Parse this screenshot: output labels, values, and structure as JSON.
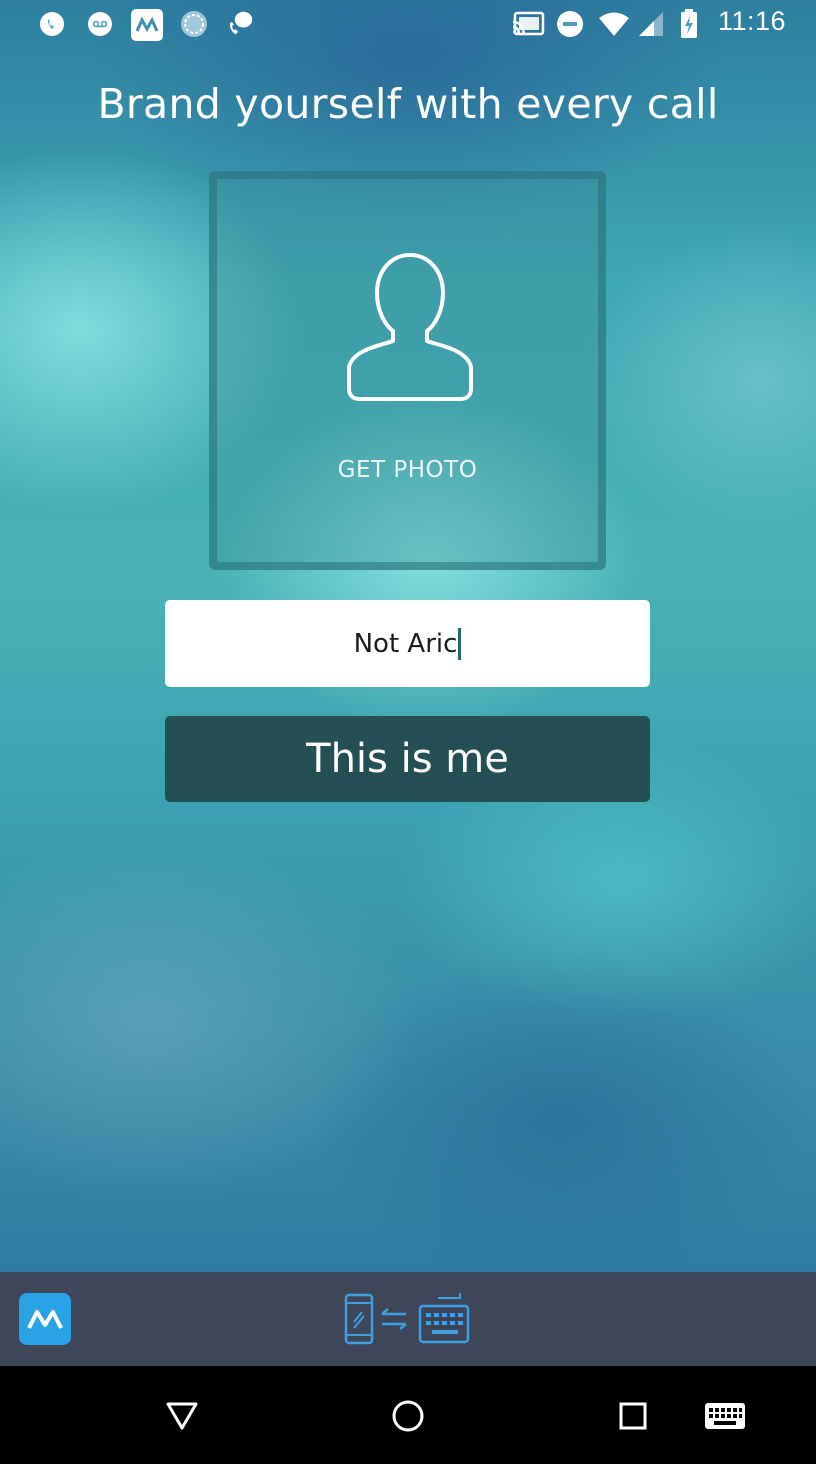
{
  "status_bar": {
    "time": "11:16",
    "left_icons": [
      "phone-icon",
      "voicemail-icon",
      "apowermirror-icon",
      "sync-circle-icon",
      "missed-call-icon"
    ],
    "right_icons": [
      "cast-icon",
      "do-not-disturb-icon",
      "wifi-icon",
      "signal-icon",
      "battery-charging-icon"
    ]
  },
  "headline": "Brand yourself with every call",
  "photo": {
    "label": "GET PHOTO",
    "icon": "person-outline-icon"
  },
  "name_input": {
    "value": "Not Aric"
  },
  "confirm_button": {
    "label": "This is me"
  },
  "app_bar": {
    "logo_icon": "apowermirror-logo-icon",
    "center_icon": "phone-to-keyboard-icon"
  },
  "nav_bar": {
    "buttons": [
      "back-icon",
      "home-icon",
      "recents-icon",
      "keyboard-icon"
    ]
  },
  "colors": {
    "confirm_button_bg": "#244f55",
    "app_bar_bg": "#3e4759",
    "logo_blue": "#2aa3e6",
    "accent_blue": "#3ea0e0"
  }
}
